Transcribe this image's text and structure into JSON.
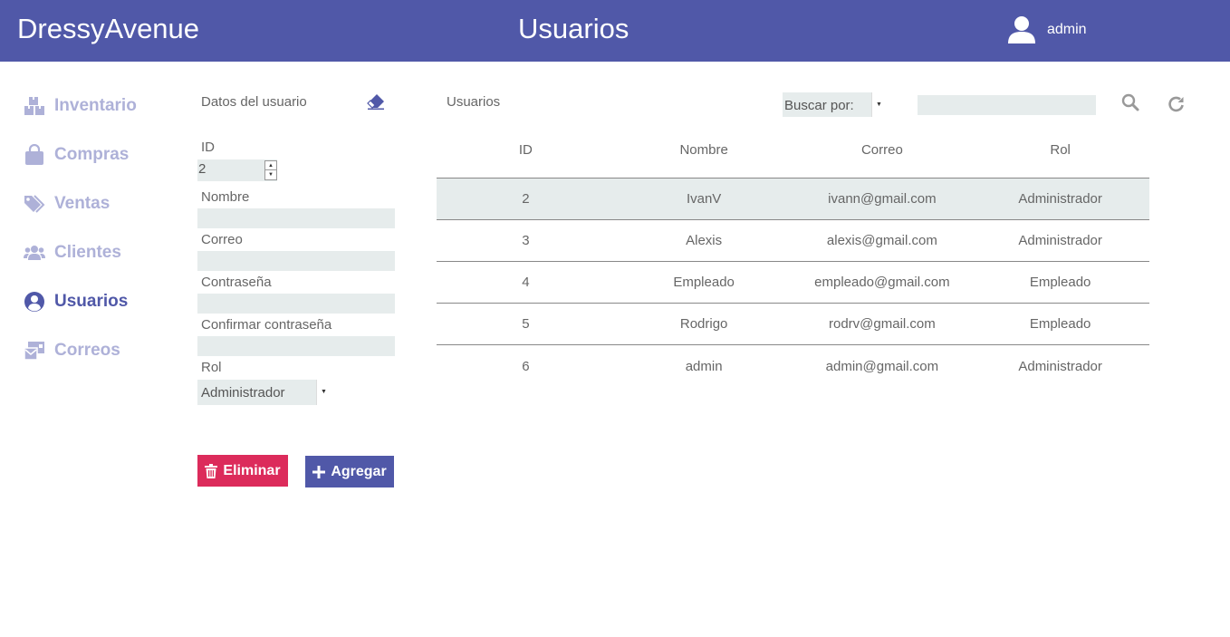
{
  "header": {
    "brand": "DressyAvenue",
    "title": "Usuarios",
    "user": "admin"
  },
  "sidebar": {
    "items": [
      {
        "label": "Inventario",
        "icon": "boxes-icon"
      },
      {
        "label": "Compras",
        "icon": "shopping-bag-icon"
      },
      {
        "label": "Ventas",
        "icon": "tags-icon"
      },
      {
        "label": "Clientes",
        "icon": "users-icon"
      },
      {
        "label": "Usuarios",
        "icon": "user-circle-icon",
        "active": true
      },
      {
        "label": "Correos",
        "icon": "mail-bulk-icon"
      }
    ]
  },
  "form": {
    "title": "Datos del usuario",
    "id_label": "ID",
    "id_value": "2",
    "nombre_label": "Nombre",
    "nombre_value": "",
    "correo_label": "Correo",
    "correo_value": "",
    "password_label": "Contraseña",
    "password_value": "",
    "confirm_label": "Confirmar contraseña",
    "confirm_value": "",
    "rol_label": "Rol",
    "rol_value": "Administrador",
    "delete_label": "Eliminar",
    "add_label": "Agregar"
  },
  "users": {
    "title": "Usuarios",
    "search_by_label": "Buscar por:",
    "search_value": "",
    "columns": [
      "ID",
      "Nombre",
      "Correo",
      "Rol"
    ],
    "rows": [
      [
        "2",
        "IvanV",
        "ivann@gmail.com",
        "Administrador"
      ],
      [
        "3",
        "Alexis",
        "alexis@gmail.com",
        "Administrador"
      ],
      [
        "4",
        "Empleado",
        "empleado@gmail.com",
        "Empleado"
      ],
      [
        "5",
        "Rodrigo",
        "rodrv@gmail.com",
        "Empleado"
      ],
      [
        "6",
        "admin",
        "admin@gmail.com",
        "Administrador"
      ]
    ],
    "selected_row": 0
  },
  "colors": {
    "primary": "#5058a8",
    "danger": "#dc2b5b",
    "nav_inactive": "#aeb1d8",
    "field_bg": "#e6ecec"
  }
}
